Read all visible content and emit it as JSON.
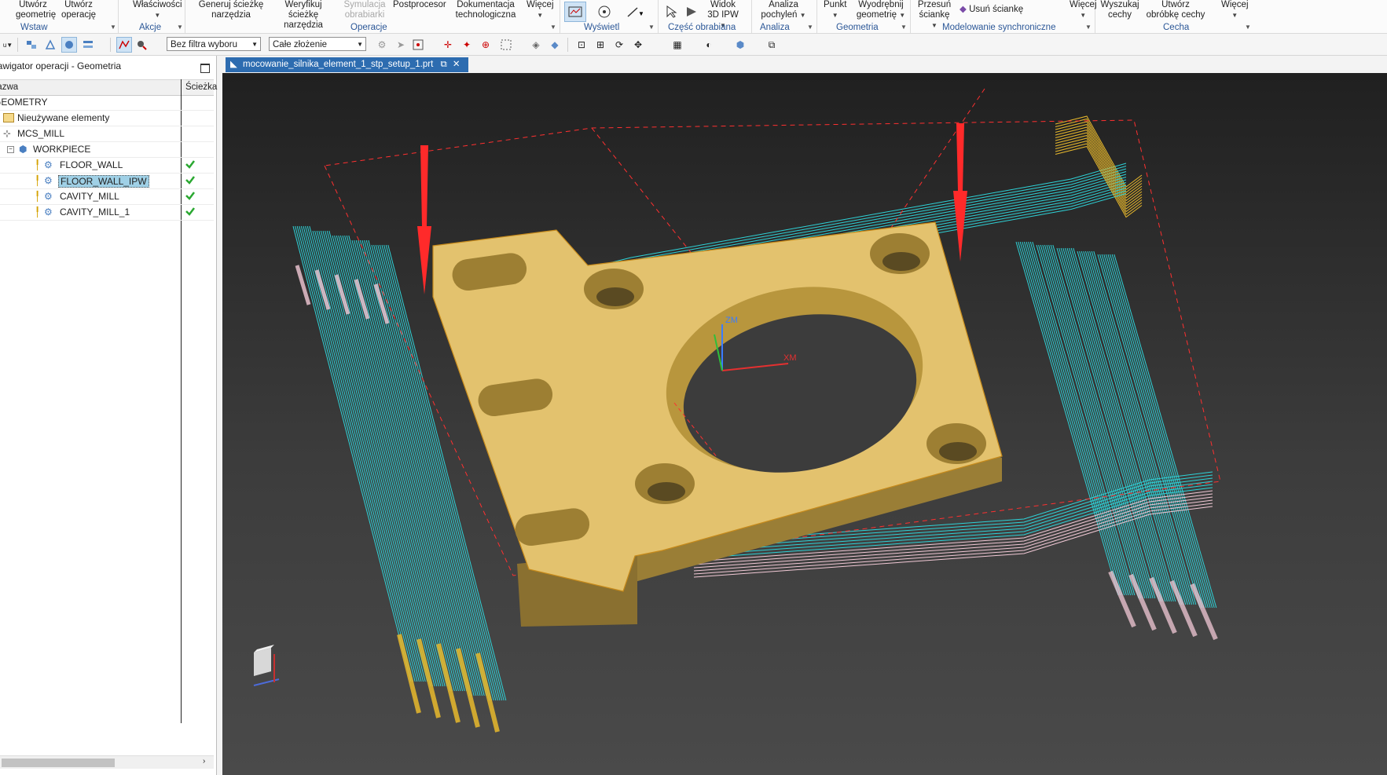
{
  "ribbon": {
    "groups": [
      {
        "label": "Wstaw",
        "buttons": [
          "Utwórz geometrię",
          "Utwórz operację"
        ]
      },
      {
        "label": "Akcje",
        "buttons": [
          "Właściwości"
        ]
      },
      {
        "label": "Operacje",
        "buttons": [
          "Generuj ścieżkę narzędzia",
          "Weryfikuj ścieżkę narzędzia",
          "Symulacja obrabiarki",
          "Postprocesor",
          "Dokumentacja technologiczna",
          "Więcej"
        ]
      },
      {
        "label": "Wyświetl",
        "buttons": []
      },
      {
        "label": "Część obrabiana",
        "buttons": [
          "Widok 3D IPW"
        ]
      },
      {
        "label": "Analiza",
        "buttons": [
          "Analiza pochyleń"
        ]
      },
      {
        "label": "Geometria",
        "buttons": [
          "Punkt",
          "Wyodrębnij geometrię"
        ]
      },
      {
        "label": "Modelowanie synchroniczne",
        "buttons": [
          "Przesuń ściankę",
          "Usuń ściankę",
          "Więcej"
        ]
      },
      {
        "label": "Cecha",
        "buttons": [
          "Wyszukaj cechy",
          "Utwórz obróbkę cechy",
          "Więcej"
        ]
      }
    ]
  },
  "toolbar": {
    "filter_value": "Bez filtra wyboru",
    "scope_value": "Całe złożenie"
  },
  "navigator": {
    "title": "Nawigator operacji - Geometria",
    "col_name": "Nazwa",
    "col_path": "Ścieżka",
    "rows": [
      {
        "name": "GEOMETRY",
        "icon": "none",
        "check": false
      },
      {
        "name": "Nieużywane elementy",
        "icon": "folder-icon",
        "check": false
      },
      {
        "name": "MCS_MILL",
        "icon": "mcs-icon",
        "check": false
      },
      {
        "name": "WORKPIECE",
        "icon": "workpiece-icon",
        "check": false
      },
      {
        "name": "FLOOR_WALL",
        "icon": "operation-icon",
        "check": true
      },
      {
        "name": "FLOOR_WALL_IPW",
        "icon": "operation-icon",
        "check": true
      },
      {
        "name": "CAVITY_MILL",
        "icon": "operation-icon",
        "check": true
      },
      {
        "name": "CAVITY_MILL_1",
        "icon": "operation-icon",
        "check": true
      }
    ]
  },
  "document_tab": "mocowanie_silnika_element_1_stp_setup_1.prt",
  "viewport": {
    "axis_labels": {
      "z": "ZM",
      "x": "XM"
    },
    "part_color": "#e3c26e",
    "toolpath_colors": {
      "cut": "#2ed3d8",
      "rapid": "#e8b92c",
      "engage": "#f2c9d6",
      "feed": "#ff2a2a"
    }
  },
  "colors": {
    "accent": "#2b5797",
    "tab": "#2d6cb0",
    "check": "#2aa831"
  }
}
